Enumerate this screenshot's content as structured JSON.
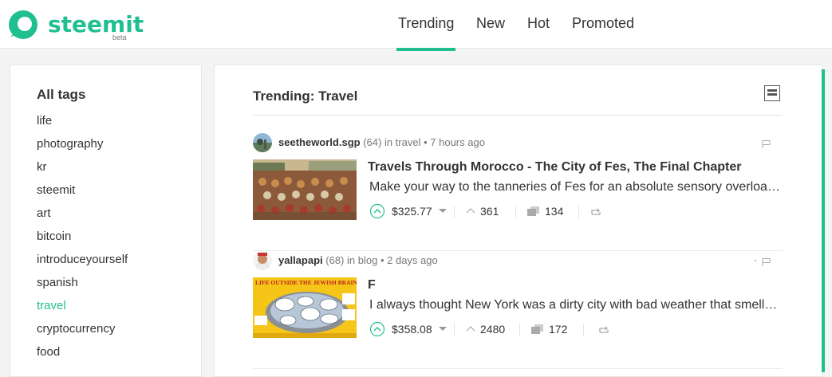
{
  "brand": {
    "name": "steemit",
    "tag": "beta",
    "color": "#1fbf8f"
  },
  "nav": {
    "items": [
      "Trending",
      "New",
      "Hot",
      "Promoted"
    ],
    "active": "Trending"
  },
  "sidebar": {
    "title": "All tags",
    "tags": [
      "life",
      "photography",
      "kr",
      "steemit",
      "art",
      "bitcoin",
      "introduceyourself",
      "spanish",
      "travel",
      "cryptocurrency",
      "food"
    ],
    "active_tag": "travel"
  },
  "main": {
    "title": "Trending: Travel",
    "posts": [
      {
        "author": "seetheworld.sgp",
        "reputation": "(64)",
        "category_prefix": "in travel",
        "time": "• 7 hours ago",
        "title": "Travels Through Morocco - The City of Fes, The Final Chapter",
        "excerpt": "Make your way to the tanneries of Fes for an absolute sensory overload experience",
        "payout": "$325.77",
        "votes": "361",
        "comments": "134"
      },
      {
        "author": "yallapapi",
        "reputation": "(68)",
        "category_prefix": "in blog",
        "time": "• 2 days ago",
        "title": "F",
        "excerpt": "I always thought New York was a dirty city with bad weather that smelled like garbage",
        "payout": "$358.08",
        "votes": "2480",
        "comments": "172",
        "thumb_caption": "LIFE OUTSIDE THE JEWISH BRAIN"
      }
    ]
  }
}
